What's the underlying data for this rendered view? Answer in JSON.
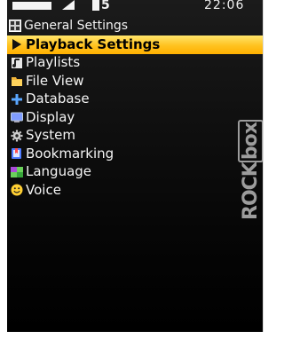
{
  "status": {
    "battery_num": "5",
    "time": "22:06"
  },
  "title": "General Settings",
  "menu": [
    {
      "label": "Playback Settings",
      "selected": true,
      "icon": "play-arrow-icon"
    },
    {
      "label": "Playlists",
      "selected": false,
      "icon": "playlist-icon"
    },
    {
      "label": "File View",
      "selected": false,
      "icon": "folder-icon"
    },
    {
      "label": "Database",
      "selected": false,
      "icon": "database-plus-icon"
    },
    {
      "label": "Display",
      "selected": false,
      "icon": "display-icon"
    },
    {
      "label": "System",
      "selected": false,
      "icon": "gear-icon"
    },
    {
      "label": "Bookmarking",
      "selected": false,
      "icon": "bookmark-icon"
    },
    {
      "label": "Language",
      "selected": false,
      "icon": "language-icon"
    },
    {
      "label": "Voice",
      "selected": false,
      "icon": "voice-smiley-icon"
    }
  ],
  "logo": {
    "text": "ROCK",
    "box": "box"
  }
}
